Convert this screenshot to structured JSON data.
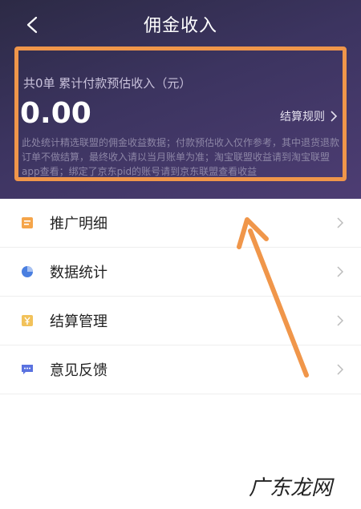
{
  "header": {
    "title": "佣金收入"
  },
  "summary": {
    "order_count_label": "共0单 累计付款预估收入（元）",
    "amount": "0.00",
    "rules_link": "结算规则",
    "note": "此处统计精选联盟的佣金收益数据；付款预估收入仅作参考，其中退货退款订单不做结算，最终收入请以当月账单为准；淘宝联盟收益请到淘宝联盟app查看；绑定了京东pid的账号请到京东联盟查看收益"
  },
  "menu": {
    "items": [
      {
        "label": "推广明细",
        "icon": "list-doc-icon",
        "color": "#f5a54a"
      },
      {
        "label": "数据统计",
        "icon": "pie-chart-icon",
        "color": "#4a7fe0"
      },
      {
        "label": "结算管理",
        "icon": "yen-card-icon",
        "color": "#f2c25a"
      },
      {
        "label": "意见反馈",
        "icon": "chat-bubble-icon",
        "color": "#5a72e0"
      }
    ]
  },
  "annotation": {
    "box_color": "#f0964a",
    "arrow_color": "#f0964a"
  },
  "watermark": "广东龙网"
}
